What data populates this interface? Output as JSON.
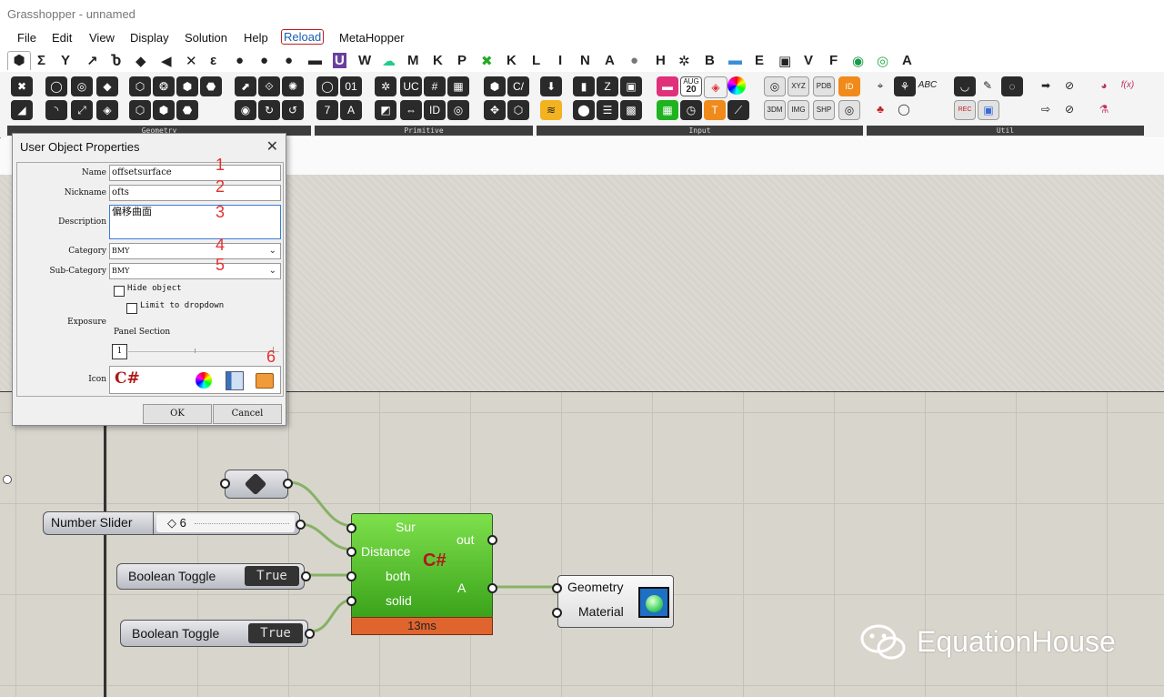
{
  "app": {
    "title": "Grasshopper - unnamed"
  },
  "menu": [
    "File",
    "Edit",
    "View",
    "Display",
    "Solution",
    "Help",
    "Reload",
    "MetaHopper"
  ],
  "tabs": [
    "Σ",
    "Y",
    "↗",
    "Ⴆ",
    "◆",
    "◀",
    "✕",
    "ε",
    "●",
    "●",
    "●",
    "▬",
    "U",
    "W",
    "☁",
    "M",
    "K",
    "P",
    "✖",
    "K",
    "L",
    "I",
    "N",
    "A",
    "●",
    "H",
    "✲",
    "B",
    "▬",
    "E",
    "▣",
    "V",
    "F",
    "◉",
    "◎",
    "A"
  ],
  "ribbon": {
    "panels": [
      {
        "name": "Geometry"
      },
      {
        "name": "Primitive"
      },
      {
        "name": "Input"
      },
      {
        "name": "Util"
      }
    ],
    "input_date_icon": {
      "month": "AUG",
      "day": "20"
    },
    "input_text_icons": [
      "XYZ",
      "PDB",
      "3DM",
      "IMG",
      "SHP",
      "ID"
    ],
    "util_abc": "ABC",
    "util_fx": "f(x)",
    "util_rec": "REC"
  },
  "dialog": {
    "title": "User Object Properties",
    "close": "✕",
    "fields": {
      "name": {
        "label": "Name",
        "value": "offsetsurface",
        "marker": "1"
      },
      "nickname": {
        "label": "Nickname",
        "value": "ofts",
        "marker": "2"
      },
      "description": {
        "label": "Description",
        "value": "偏移曲面",
        "marker": "3"
      },
      "category": {
        "label": "Category",
        "value": "BMY",
        "marker": "4"
      },
      "subcategory": {
        "label": "Sub-Category",
        "value": "BMY",
        "marker": "5"
      }
    },
    "exposure": {
      "label": "Exposure",
      "hide_object": "Hide object",
      "limit_dropdown": "Limit to dropdown",
      "panel_section": "Panel Section",
      "section_value": "1",
      "marker": "6"
    },
    "icon_label": "Icon",
    "icon_glyph": "C#",
    "ok": "OK",
    "cancel": "Cancel"
  },
  "canvas": {
    "number_slider": {
      "label": "Number Slider",
      "value": "◇ 6"
    },
    "toggle1": {
      "label": "Boolean Toggle",
      "value": "True"
    },
    "toggle2": {
      "label": "Boolean Toggle",
      "value": "True"
    },
    "script": {
      "inputs": [
        "Sur",
        "Distance",
        "both",
        "solid"
      ],
      "outputs": [
        "out",
        "A"
      ],
      "glyph": "C#",
      "timer": "13ms"
    },
    "preview": {
      "inputs": [
        "Geometry",
        "Material"
      ]
    }
  },
  "watermark": {
    "text": "EquationHouse"
  },
  "colors": {
    "accent_red": "#e53030",
    "component_green": "#5cc235",
    "timer_orange": "#e0642e"
  }
}
